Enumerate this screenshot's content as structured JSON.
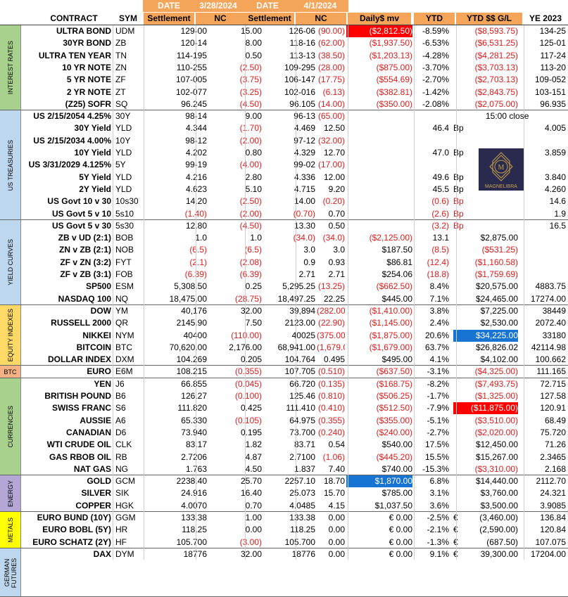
{
  "header": {
    "top": {
      "date1_label": "DATE",
      "date1": "3/28/2024",
      "date2_label": "DATE",
      "date2": "4/1/2024"
    },
    "cols": [
      "CONTRACT",
      "SYM",
      "Settlement",
      "NC",
      "Settlement",
      "NC",
      "Daily$ mv",
      "YTD",
      "YTD $$ G/L",
      "YE 2023"
    ]
  },
  "categories": [
    {
      "label": "INTEREST RATES",
      "color": "#a9d18e",
      "start": 0,
      "count": 7
    },
    {
      "label": "US TREASURIES",
      "color": "#bdd7ee",
      "start": 7,
      "count": 9
    },
    {
      "label": "YIELD CURVES",
      "color": "#bdd7ee",
      "start": 16,
      "count": 7
    },
    {
      "label": "EQUITY INDEXES",
      "color": "#ffd966",
      "start": 23,
      "count": 5
    },
    {
      "label": "BTC",
      "color": "#f4b183",
      "start": 28,
      "count": 1
    },
    {
      "label": "CURRENCIES",
      "color": "#a9d18e",
      "start": 29,
      "count": 8
    },
    {
      "label": "ENERGY",
      "color": "#b4a7d6",
      "start": 37,
      "count": 3
    },
    {
      "label": "METALS",
      "color": "#ffff00",
      "start": 40,
      "count": 3
    },
    {
      "label": "GERMAN FUTURES",
      "color": "#bdd7ee",
      "start": 43,
      "count": 4
    }
  ],
  "rows": [
    {
      "contract": "ULTRA BOND",
      "sym": "UDM",
      "s1": "129-00",
      "nc1": "15.00",
      "s2": "126-06",
      "nc2": "(90.00)",
      "daily": "($2,812.50)",
      "ytd": "-8.59%",
      "gl": "($8,593.75)",
      "ye": "134-25",
      "hl": "daily-red"
    },
    {
      "contract": "30YR BOND",
      "sym": "ZB",
      "s1": "120-14",
      "nc1": "8.00",
      "s2": "118-16",
      "nc2": "(62.00)",
      "daily": "($1,937.50)",
      "ytd": "-6.53%",
      "gl": "($6,531.25)",
      "ye": "125-01"
    },
    {
      "contract": "ULTRA TEN YEAR",
      "sym": "TN",
      "s1": "114-195",
      "nc1": "0.50",
      "s2": "113-13",
      "nc2": "(38.50)",
      "daily": "($1,203.13)",
      "ytd": "-4.28%",
      "gl": "($4,281.25)",
      "ye": "117-24"
    },
    {
      "contract": "10 YR NOTE",
      "sym": "ZN",
      "s1": "110-255",
      "nc1": "(2.50)",
      "s2": "109-295",
      "nc2": "(28.00)",
      "daily": "($875.00)",
      "ytd": "-3.70%",
      "gl": "($3,703.13)",
      "ye": "113-20"
    },
    {
      "contract": "5 YR NOTE",
      "sym": "ZF",
      "s1": "107-005",
      "nc1": "(3.75)",
      "s2": "106-147",
      "nc2": "(17.75)",
      "daily": "($554.69)",
      "ytd": "-2.70%",
      "gl": "($2,703.13)",
      "ye": "109-052"
    },
    {
      "contract": "2 YR NOTE",
      "sym": "ZT",
      "s1": "102-077",
      "nc1": "(3.25)",
      "s2": "102-016",
      "nc2": "(6.13)",
      "daily": "($382.81)",
      "ytd": "-1.42%",
      "gl": "($2,843.75)",
      "ye": "103-151"
    },
    {
      "contract": "(Z25) SOFR",
      "sym": "SQ",
      "s1": "96.245",
      "nc1": "(4.50)",
      "s2": "96.105",
      "nc2": "(14.00)",
      "daily": "($350.00)",
      "ytd": "-2.08%",
      "gl": "($2,075.00)",
      "ye": "96.935"
    },
    {
      "contract": "US 2/15/2054 4.25%",
      "sym": "30Y",
      "s1": "98-14",
      "nc1": "9.00",
      "s2": "96-13",
      "nc2": "(65.00)",
      "daily": "",
      "ytd": "",
      "gl": "15:00 close",
      "ye": ""
    },
    {
      "contract": "30Y Yield",
      "sym": "YLD",
      "s1": "4.344",
      "nc1": "(1.70)",
      "s2": "4.469",
      "nc2": "12.50",
      "daily": "",
      "ytd": "46.4",
      "unit": "Bp",
      "gl": "",
      "ye": "4.005"
    },
    {
      "contract": "US 2/15/2034 4.00%",
      "sym": "10Y",
      "s1": "98-12",
      "nc1": "(2.00)",
      "s2": "97-12",
      "nc2": "(32.00)",
      "daily": "",
      "ytd": "",
      "gl": "",
      "ye": ""
    },
    {
      "contract": "10Y Yield",
      "sym": "YLD",
      "s1": "4.202",
      "nc1": "0.80",
      "s2": "4.329",
      "nc2": "12.70",
      "daily": "",
      "ytd": "47.0",
      "unit": "Bp",
      "gl": "",
      "ye": "3.859"
    },
    {
      "contract": "US 3/31/2029 4.125%",
      "sym": "5Y",
      "s1": "99-19",
      "nc1": "(4.00)",
      "s2": "99-02",
      "nc2": "(17.00)",
      "daily": "",
      "ytd": "",
      "gl": "",
      "ye": ""
    },
    {
      "contract": "5Y Yield",
      "sym": "YLD",
      "s1": "4.216",
      "nc1": "2.80",
      "s2": "4.336",
      "nc2": "12.00",
      "daily": "",
      "ytd": "49.6",
      "unit": "Bp",
      "gl": "",
      "ye": "3.840"
    },
    {
      "contract": "2Y Yield",
      "sym": "YLD",
      "s1": "4.623",
      "nc1": "5.10",
      "s2": "4.715",
      "nc2": "9.20",
      "daily": "",
      "ytd": "45.5",
      "unit": "Bp",
      "gl": "",
      "ye": "4.260"
    },
    {
      "contract": "US Govt 10 v 30",
      "sym": "10s30",
      "s1": "14.20",
      "nc1": "(2.50)",
      "s2": "14.00",
      "nc2": "(0.20)",
      "daily": "",
      "ytd": "(0.6)",
      "unit": "Bp",
      "gl": "",
      "ye": "14.6"
    },
    {
      "contract": "US Govt 5 v 10",
      "sym": "5s10",
      "s1": "(1.40)",
      "nc1": "(2.00)",
      "s2": "(0.70)",
      "nc2": "0.70",
      "daily": "",
      "ytd": "(2.6)",
      "unit": "Bp",
      "gl": "",
      "ye": "1.9"
    },
    {
      "contract": "US Govt 5 v 30",
      "sym": "5s30",
      "s1": "12.80",
      "nc1": "(4.50)",
      "s2": "13.30",
      "nc2": "0.50",
      "daily": "",
      "ytd": "(3.2)",
      "unit": "Bp",
      "gl": "",
      "ye": "16.5"
    },
    {
      "contract": "ZB v UD (2:1)",
      "sym": "BOB",
      "s1": "1.0",
      "nc1": "1.0",
      "s2": "(34.0)",
      "nc2": "(34.0)",
      "daily": "($2,125.00)",
      "ytd": "13.1",
      "gl": "$2,875.00",
      "ye": ""
    },
    {
      "contract": "ZN v ZB (2:1)",
      "sym": "NOB",
      "s1": "(6.5)",
      "nc1": "(6.5)",
      "s2": "3.0",
      "nc2": "3.0",
      "daily": "$187.50",
      "ytd": "(8.5)",
      "gl": "($531.25)",
      "ye": ""
    },
    {
      "contract": "ZF v ZN (3:2)",
      "sym": "FYT",
      "s1": "(2.1)",
      "nc1": "(2.08)",
      "s2": "0.9",
      "nc2": "0.93",
      "daily": "$86.81",
      "ytd": "(12.4)",
      "gl": "($1,160.58)",
      "ye": ""
    },
    {
      "contract": "ZF v ZB (3:1)",
      "sym": "FOB",
      "s1": "(6.39)",
      "nc1": "(6.39)",
      "s2": "2.71",
      "nc2": "2.71",
      "daily": "$254.06",
      "ytd": "(18.8)",
      "gl": "($1,759.69)",
      "ye": ""
    },
    {
      "contract": "SP500",
      "sym": "ESM",
      "s1": "5,308.50",
      "nc1": "0.25",
      "s2": "5,295.25",
      "nc2": "(13.25)",
      "daily": "($662.50)",
      "ytd": "8.4%",
      "gl": "$20,575.00",
      "ye": "4883.75"
    },
    {
      "contract": "NASDAQ 100",
      "sym": "NQ",
      "s1": "18,475.00",
      "nc1": "(28.75)",
      "s2": "18,497.25",
      "nc2": "22.25",
      "daily": "$445.00",
      "ytd": "7.1%",
      "gl": "$24,465.00",
      "ye": "17274.00"
    },
    {
      "contract": "DOW",
      "sym": "YM",
      "s1": "40,176",
      "nc1": "32.00",
      "s2": "39,894",
      "nc2": "(282.00)",
      "daily": "($1,410.00)",
      "ytd": "3.8%",
      "gl": "$7,225.00",
      "ye": "38449"
    },
    {
      "contract": "RUSSELL 2000",
      "sym": "QR",
      "s1": "2145.90",
      "nc1": "7.50",
      "s2": "2123.00",
      "nc2": "(22.90)",
      "daily": "($1,145.00)",
      "ytd": "2.4%",
      "gl": "$2,530.00",
      "ye": "2072.40"
    },
    {
      "contract": "NIKKEI",
      "sym": "NYM",
      "s1": "40400",
      "nc1": "(110.00)",
      "s2": "40025",
      "nc2": "(375.00)",
      "daily": "($1,875.00)",
      "ytd": "20.6%",
      "gl": "$34,225.00",
      "ye": "33180",
      "hl": "gl-blue"
    },
    {
      "contract": "BITCOIN",
      "sym": "BTC",
      "s1": "70,620.00",
      "nc1": "2,176.00",
      "s2": "68,941.00",
      "nc2": "(1,679.00)",
      "daily": "($1,679.00)",
      "ytd": "63.7%",
      "gl": "$26,826.02",
      "ye": "42114.98"
    },
    {
      "contract": "DOLLAR INDEX",
      "sym": "DXM",
      "s1": "104.269",
      "nc1": "0.205",
      "s2": "104.764",
      "nc2": "0.495",
      "daily": "$495.00",
      "ytd": "4.1%",
      "gl": "$4,102.00",
      "ye": "100.662"
    },
    {
      "contract": "EURO",
      "sym": "E6M",
      "s1": "108.215",
      "nc1": "(0.355)",
      "s2": "107.705",
      "nc2": "(0.510)",
      "daily": "($637.50)",
      "ytd": "-3.1%",
      "gl": "($4,325.00)",
      "ye": "111.165"
    },
    {
      "contract": "YEN",
      "sym": "J6",
      "s1": "66.855",
      "nc1": "(0.045)",
      "s2": "66.720",
      "nc2": "(0.135)",
      "daily": "($168.75)",
      "ytd": "-8.2%",
      "gl": "($7,493.75)",
      "ye": "72.715"
    },
    {
      "contract": "BRITISH POUND",
      "sym": "B6",
      "s1": "126.27",
      "nc1": "(0.100)",
      "s2": "125.46",
      "nc2": "(0.810)",
      "daily": "($506.25)",
      "ytd": "-1.7%",
      "gl": "($1,325.00)",
      "ye": "127.58"
    },
    {
      "contract": "SWISS FRANC",
      "sym": "S6",
      "s1": "111.820",
      "nc1": "0.425",
      "s2": "111.410",
      "nc2": "(0.410)",
      "daily": "($512.50)",
      "ytd": "-7.9%",
      "gl": "($11,875.00)",
      "ye": "120.91",
      "hl": "gl-red"
    },
    {
      "contract": "AUSSIE",
      "sym": "A6",
      "s1": "65.330",
      "nc1": "(0.105)",
      "s2": "64.975",
      "nc2": "(0.355)",
      "daily": "($355.00)",
      "ytd": "-5.1%",
      "gl": "($3,510.00)",
      "ye": "68.49"
    },
    {
      "contract": "CANADIAN",
      "sym": "D6",
      "s1": "73.940",
      "nc1": "0.195",
      "s2": "73.700",
      "nc2": "(0.240)",
      "daily": "($240.00)",
      "ytd": "-2.7%",
      "gl": "($2,020.00)",
      "ye": "75.720"
    },
    {
      "contract": "WTI CRUDE OIL",
      "sym": "CLK",
      "s1": "83.17",
      "nc1": "1.82",
      "s2": "83.71",
      "nc2": "0.54",
      "daily": "$540.00",
      "ytd": "17.5%",
      "gl": "$12,450.00",
      "ye": "71.26"
    },
    {
      "contract": "GAS RBOB OIL",
      "sym": "RB",
      "s1": "2.7206",
      "nc1": "4.87",
      "s2": "2.7100",
      "nc2": "(1.06)",
      "daily": "($445.20)",
      "ytd": "15.5%",
      "gl": "$15,267.00",
      "ye": "2.3465"
    },
    {
      "contract": "NAT GAS",
      "sym": "NG",
      "s1": "1.763",
      "nc1": "4.50",
      "s2": "1.837",
      "nc2": "7.40",
      "daily": "$740.00",
      "ytd": "-15.3%",
      "gl": "($3,310.00)",
      "ye": "2.168"
    },
    {
      "contract": "GOLD",
      "sym": "GCM",
      "s1": "2238.40",
      "nc1": "25.70",
      "s2": "2257.10",
      "nc2": "18.70",
      "daily": "$1,870.00",
      "ytd": "6.8%",
      "gl": "$14,440.00",
      "ye": "2112.70",
      "hl": "daily-blue"
    },
    {
      "contract": "SILVER",
      "sym": "SIK",
      "s1": "24.916",
      "nc1": "16.40",
      "s2": "25.073",
      "nc2": "15.70",
      "daily": "$785.00",
      "ytd": "3.1%",
      "gl": "$3,760.00",
      "ye": "24.321"
    },
    {
      "contract": "COPPER",
      "sym": "HGK",
      "s1": "4.0070",
      "nc1": "0.70",
      "s2": "4.0485",
      "nc2": "4.15",
      "daily": "$1,037.50",
      "ytd": "3.6%",
      "gl": "$3,500.00",
      "ye": "3.9085"
    },
    {
      "contract": "EURO BUND (10Y)",
      "sym": "GGM",
      "s1": "133.38",
      "nc1": "1.00",
      "s2": "133.38",
      "nc2": "0.00",
      "daily": "€ 0.00",
      "ytd": "-2.5%",
      "eur": "€",
      "gl": "(3,460.00)",
      "ye": "136.84"
    },
    {
      "contract": "EURO BOBL (5Y)",
      "sym": "HR",
      "s1": "118.25",
      "nc1": "0.00",
      "s2": "118.25",
      "nc2": "0.00",
      "daily": "€ 0.00",
      "ytd": "-2.1%",
      "eur": "€",
      "gl": "(2,590.00)",
      "ye": "120.84"
    },
    {
      "contract": "EURO SCHATZ (2Y)",
      "sym": "HF",
      "s1": "105.700",
      "nc1": "(3.00)",
      "s2": "105.700",
      "nc2": "0.00",
      "daily": "€ 0.00",
      "ytd": "-1.3%",
      "eur": "€",
      "gl": "(687.50)",
      "ye": "107.075"
    },
    {
      "contract": "DAX",
      "sym": "DYM",
      "s1": "18776",
      "nc1": "32.00",
      "s2": "18776",
      "nc2": "0.00",
      "daily": "€ 0.00",
      "ytd": "9.1%",
      "eur": "€",
      "gl": "39,300.00",
      "ye": "17204.00"
    }
  ],
  "logo": {
    "text": "MAGNELIBRA",
    "monogram": "M"
  }
}
